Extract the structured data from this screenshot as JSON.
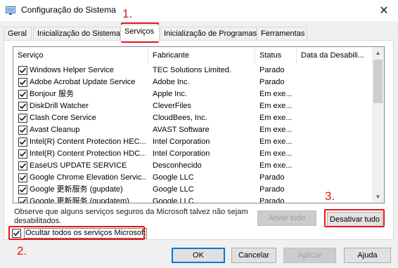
{
  "window": {
    "title": "Configuração do Sistema",
    "close_glyph": "✕"
  },
  "tabs": [
    {
      "label": "Geral",
      "active": false
    },
    {
      "label": "Inicialização do Sistema",
      "active": false
    },
    {
      "label": "Serviços",
      "active": true
    },
    {
      "label": "Inicialização de Programas",
      "active": false
    },
    {
      "label": "Ferramentas",
      "active": false
    }
  ],
  "table": {
    "columns": [
      "Serviço",
      "Fabricante",
      "Status",
      "Data da Desabili..."
    ],
    "rows": [
      {
        "checked": true,
        "service": "Windows Helper Service",
        "maker": "TEC Solutions Limited.",
        "status": "Parado"
      },
      {
        "checked": true,
        "service": "Adobe Acrobat Update Service",
        "maker": "Adobe Inc.",
        "status": "Parado"
      },
      {
        "checked": true,
        "service": "Bonjour 服务",
        "maker": "Apple Inc.",
        "status": "Em exe..."
      },
      {
        "checked": true,
        "service": "DiskDrill Watcher",
        "maker": "CleverFiles",
        "status": "Em exe..."
      },
      {
        "checked": true,
        "service": "Clash Core Service",
        "maker": "CloudBees, Inc.",
        "status": "Em exe..."
      },
      {
        "checked": true,
        "service": "Avast Cleanup",
        "maker": "AVAST Software",
        "status": "Em exe..."
      },
      {
        "checked": true,
        "service": "Intel(R) Content Protection HEC...",
        "maker": "Intel Corporation",
        "status": "Em exe..."
      },
      {
        "checked": true,
        "service": "Intel(R) Content Protection HDC...",
        "maker": "Intel Corporation",
        "status": "Em exe..."
      },
      {
        "checked": true,
        "service": "EaseUS UPDATE SERVICE",
        "maker": "Desconhecido",
        "status": "Em exe..."
      },
      {
        "checked": true,
        "service": "Google Chrome Elevation Servic...",
        "maker": "Google LLC",
        "status": "Parado"
      },
      {
        "checked": true,
        "service": "Google 更新服务 (gupdate)",
        "maker": "Google LLC",
        "status": "Parado"
      },
      {
        "checked": true,
        "service": "Google 更新服务 (gupdatem)",
        "maker": "Google LLC",
        "status": "Parado"
      }
    ]
  },
  "note": "Observe que alguns serviços seguros da Microsoft talvez não sejam desabilitados.",
  "buttons": {
    "enable_all": "Ativar tudo",
    "disable_all": "Desativar tudo",
    "ok": "OK",
    "cancel": "Cancelar",
    "apply": "Aplicar",
    "help": "Ajuda"
  },
  "hide_ms": {
    "label": "Ocultar todos os serviços Microsoft",
    "checked": true
  },
  "annotations": {
    "step1": "1.",
    "step2": "2.",
    "step3": "3.",
    "color": "#e8141b"
  }
}
